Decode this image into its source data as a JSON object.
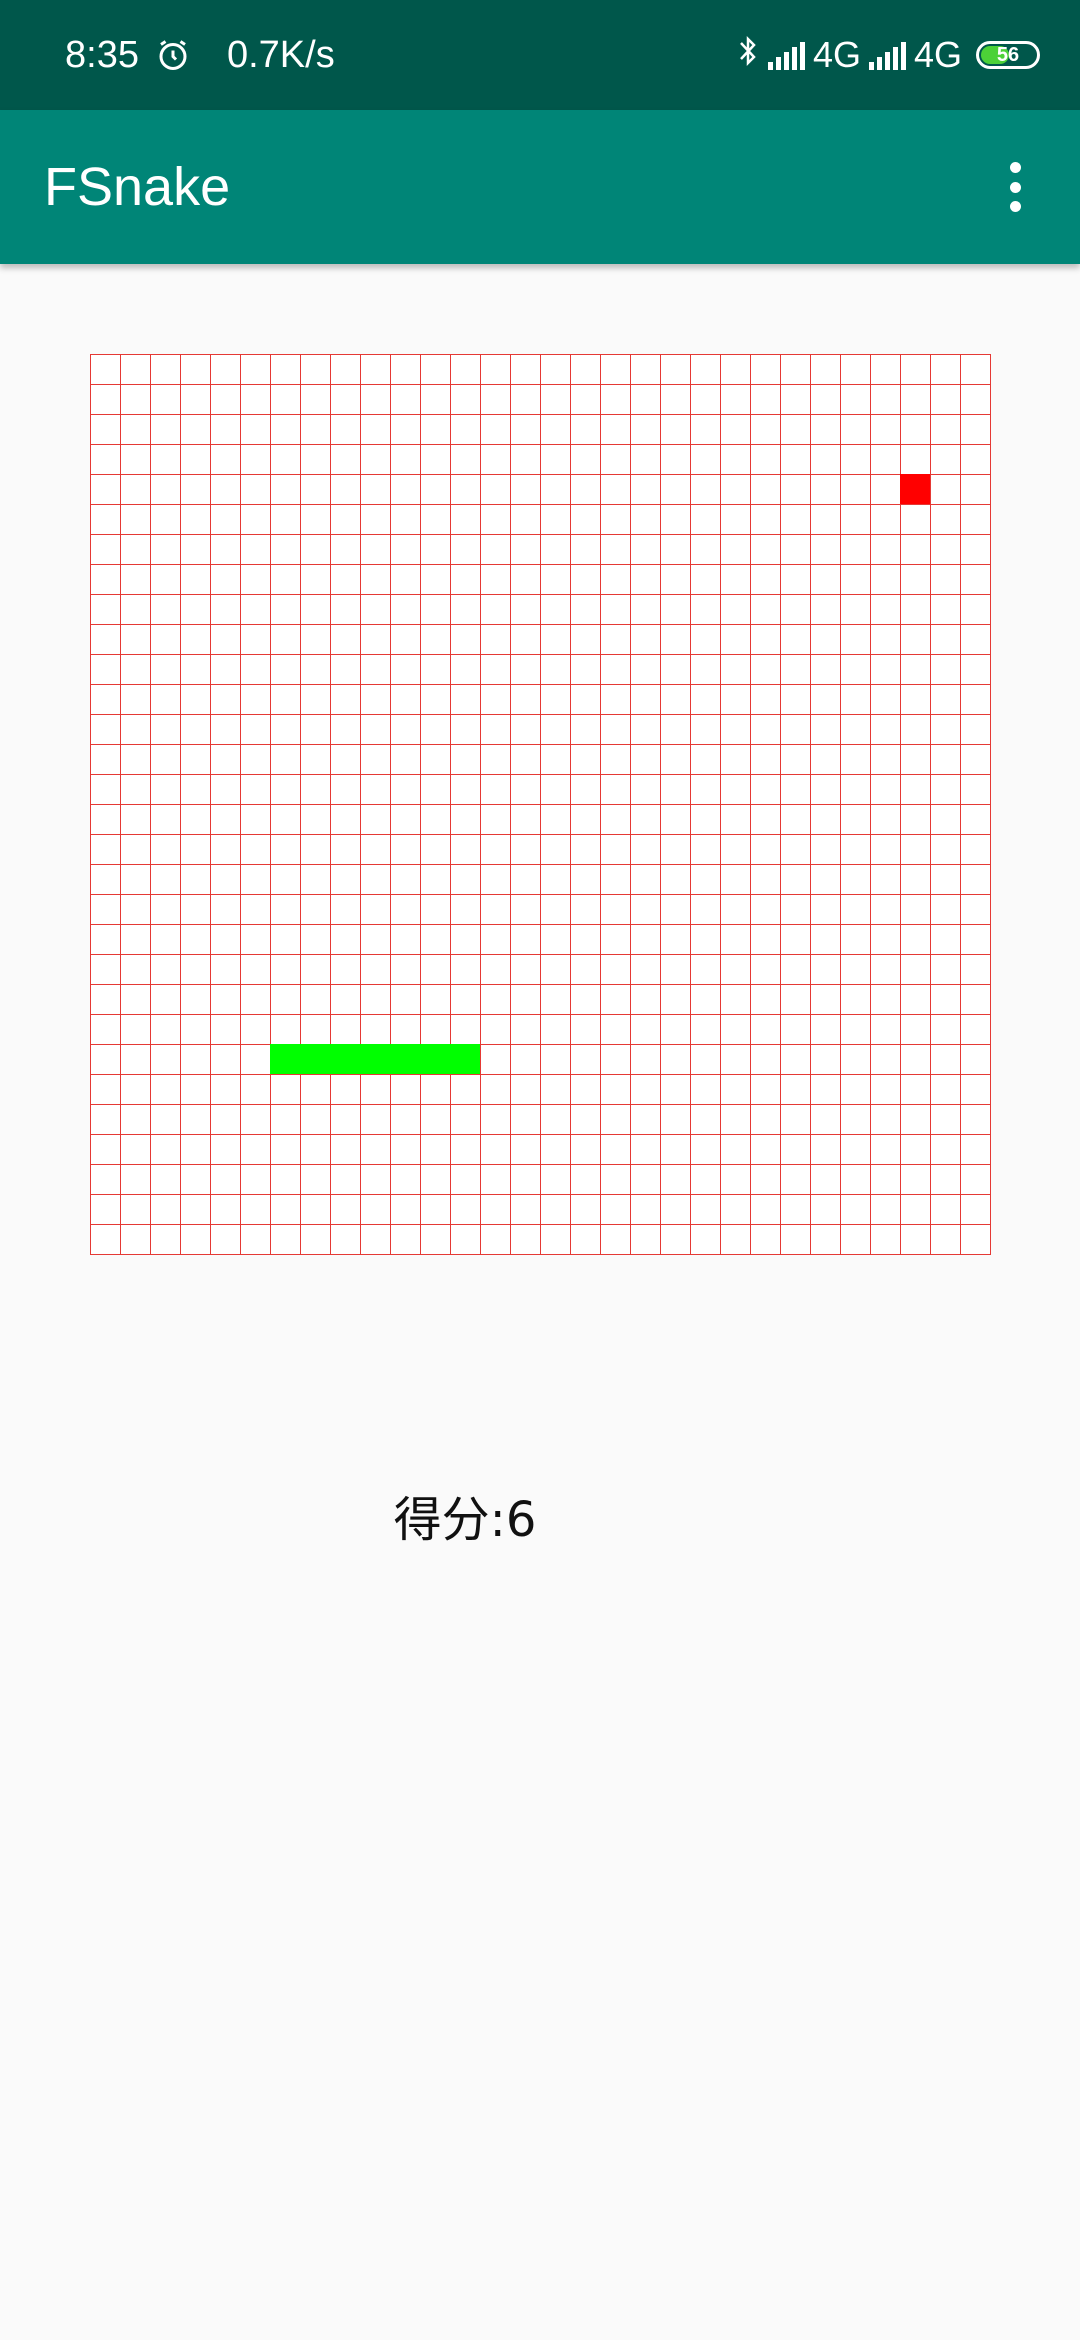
{
  "status_bar": {
    "time": "8:35",
    "net_speed": "0.7K/s",
    "alarm_icon": "alarm-icon",
    "bluetooth_icon": "bluetooth-icon",
    "network1": "4G",
    "network2": "4G",
    "battery": "56",
    "battery_level": 56
  },
  "app_bar": {
    "title": "FSnake",
    "menu_icon": "more-vert-icon"
  },
  "game": {
    "grid_columns": 30,
    "grid_rows": 30,
    "grid_color": "#e53935",
    "snake_color": "#00ff00",
    "food_color": "#ff0000",
    "snake_cells": [
      [
        6,
        23
      ],
      [
        7,
        23
      ],
      [
        8,
        23
      ],
      [
        9,
        23
      ],
      [
        10,
        23
      ],
      [
        11,
        23
      ],
      [
        12,
        23
      ]
    ],
    "food_cell": [
      27,
      4
    ]
  },
  "score": {
    "text": "得分:6",
    "value": 6
  }
}
